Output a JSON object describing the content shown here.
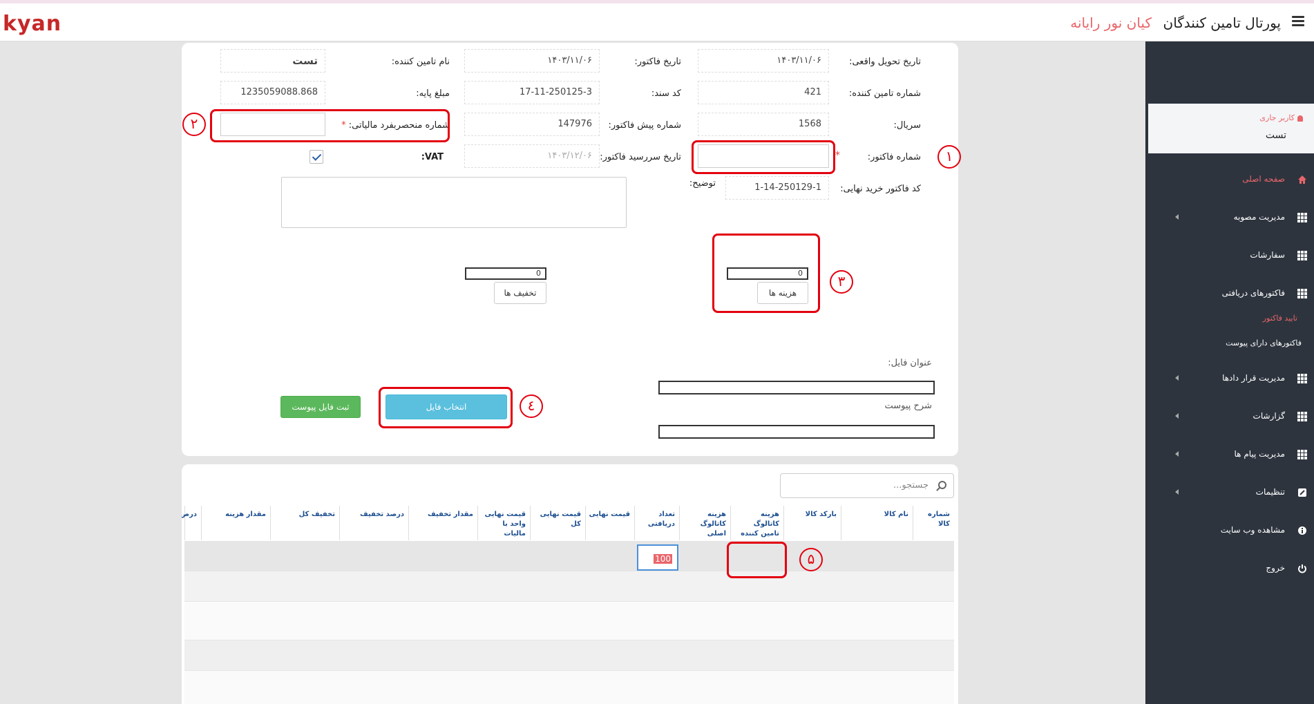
{
  "header": {
    "logo": "kyan",
    "portal_title": "پورتال تامین کنندگان",
    "company_name": "کیان نور رایانه"
  },
  "sidebar": {
    "user_label": "کاربر جاری",
    "user_name": "تست",
    "items": [
      {
        "label": "صفحه اصلی",
        "icon": "home-icon",
        "active": true
      },
      {
        "label": "مدیریت مصوبه",
        "icon": "grid-icon",
        "has_submenu": true
      },
      {
        "label": "سفارشات",
        "icon": "grid-icon"
      },
      {
        "label": "فاکتورهای دریافتی",
        "icon": "grid-icon"
      },
      {
        "label": "مدیریت قرار دادها",
        "icon": "grid-icon",
        "has_submenu": true
      },
      {
        "label": "گزارشات",
        "icon": "grid-icon",
        "has_submenu": true
      },
      {
        "label": "مدیریت پیام ها",
        "icon": "grid-icon",
        "has_submenu": true
      },
      {
        "label": "تنظیمات",
        "icon": "edit-icon",
        "has_submenu": true
      },
      {
        "label": "مشاهده وب سایت",
        "icon": "info-icon"
      },
      {
        "label": "خروج",
        "icon": "power-icon"
      }
    ],
    "subitems": [
      {
        "label": "تایید فاکتور",
        "active": true
      },
      {
        "label": "فاکتورهای دارای پیوست",
        "active": false
      }
    ]
  },
  "form": {
    "delivery_date_label": "تاریخ تحویل واقعی:",
    "delivery_date": "۱۴۰۳/۱۱/۰۶",
    "invoice_date_label": "تاریخ فاکتور:",
    "invoice_date": "۱۴۰۳/۱۱/۰۶",
    "supplier_name_label": "نام تامین کننده:",
    "supplier_name": "تست",
    "supplier_number_label": "شماره تامین کننده:",
    "supplier_number": "421",
    "doc_code_label": "کد سند:",
    "doc_code": "17-11-250125-3",
    "base_amount_label": "مبلغ پایه:",
    "base_amount": "1235059088.868",
    "serial_label": "سریال:",
    "serial": "1568",
    "proforma_number_label": "شماره پیش فاکتور:",
    "proforma_number": "147976",
    "tax_id_label": "شماره منحصربفرد مالیاتی:",
    "tax_id": "",
    "invoice_number_label": "شماره فاکتور:",
    "invoice_number": "",
    "due_date_label": "تاریخ سررسید فاکتور:",
    "due_date": "۱۴۰۳/۱۲/۰۶",
    "vat_label": "VAT:",
    "vat_checked": true,
    "final_code_label": "کد فاکتور خرید نهایی:",
    "final_code": "1-14-250129-1",
    "description_label": "توضیح:",
    "required_mark": "*",
    "costs_value": "0",
    "costs_button": "هزینه ها",
    "discounts_value": "0",
    "discounts_button": "تخفیف ها",
    "file_title_label": "عنوان فایل:",
    "attachment_desc_label": "شرح پیوست",
    "choose_file_button": "انتخاب فایل",
    "submit_attachment_button": "ثبت فایل پیوست"
  },
  "annotations": [
    "۱",
    "۲",
    "۳",
    "٤",
    "۵"
  ],
  "table": {
    "search_placeholder": "جستجو...",
    "columns": [
      "شماره کالا",
      "نام کالا",
      "بارکد کالا",
      "هزینه کاتالوگ تامین کننده",
      "هزینه کاتالوگ اصلی",
      "تعداد دریافتی",
      "قیمت نهایی",
      "قیمت نهایی کل",
      "قیمت نهایی واحد با مالیات",
      "مقدار تخفیف",
      "درصد تخفیف",
      "تخفیف کل",
      "مقدار هزینه",
      "درص"
    ],
    "edit_value": "100"
  }
}
